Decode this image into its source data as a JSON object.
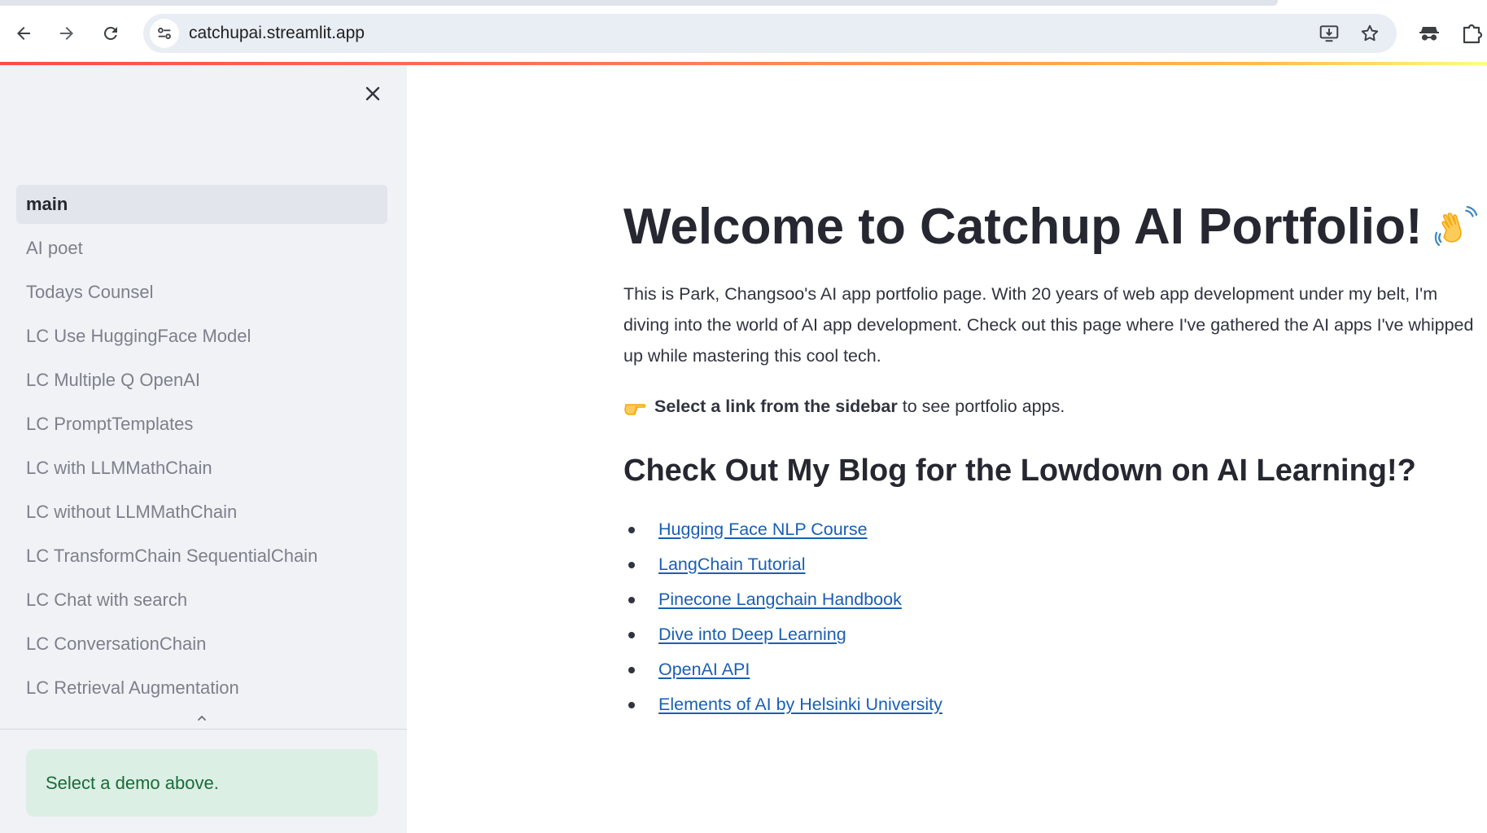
{
  "browser": {
    "url": "catchupai.streamlit.app"
  },
  "sidebar": {
    "items": [
      {
        "label": "main",
        "active": true
      },
      {
        "label": "AI poet"
      },
      {
        "label": "Todays Counsel"
      },
      {
        "label": "LC Use HuggingFace Model"
      },
      {
        "label": "LC Multiple Q OpenAI"
      },
      {
        "label": "LC PromptTemplates"
      },
      {
        "label": "LC with LLMMathChain"
      },
      {
        "label": "LC without LLMMathChain"
      },
      {
        "label": "LC TransformChain SequentialChain"
      },
      {
        "label": "LC Chat with search"
      },
      {
        "label": "LC ConversationChain"
      },
      {
        "label": "LC Retrieval Augmentation"
      }
    ],
    "info_message": "Select a demo above."
  },
  "main": {
    "title": "Welcome to Catchup AI Portfolio!",
    "intro": "This is Park, Changsoo's AI app portfolio page. With 20 years of web app development under my belt, I'm diving into the world of AI app development. Check out this page where I've gathered the AI apps I've whipped up while mastering this cool tech.",
    "select_bold": "Select a link from the sidebar",
    "select_rest": "to see portfolio apps.",
    "blog_heading": "Check Out My Blog for the Lowdown on AI Learning!?",
    "links": [
      "Hugging Face NLP Course",
      "LangChain Tutorial",
      "Pinecone Langchain Handbook",
      "Dive into Deep Learning",
      "OpenAI API",
      "Elements of AI by Helsinki University"
    ]
  },
  "icons": {
    "back": "arrow-left-icon",
    "forward": "arrow-right-icon",
    "reload": "reload-icon",
    "site_info": "tune-icon",
    "install": "install-app-icon",
    "bookmark": "star-icon",
    "incognito": "incognito-icon",
    "extensions": "puzzle-icon",
    "close": "close-icon",
    "collapse": "chevron-up-icon",
    "wave": "waving-hand-icon",
    "point": "pointing-hand-icon"
  },
  "colors": {
    "accent_bar_start": "#ff4b4b",
    "accent_bar_end": "#fffd80",
    "sidebar_bg": "#f0f2f6",
    "link": "#1a5fb4",
    "success_bg": "#dcefe4",
    "success_text": "#1a6b3a"
  }
}
